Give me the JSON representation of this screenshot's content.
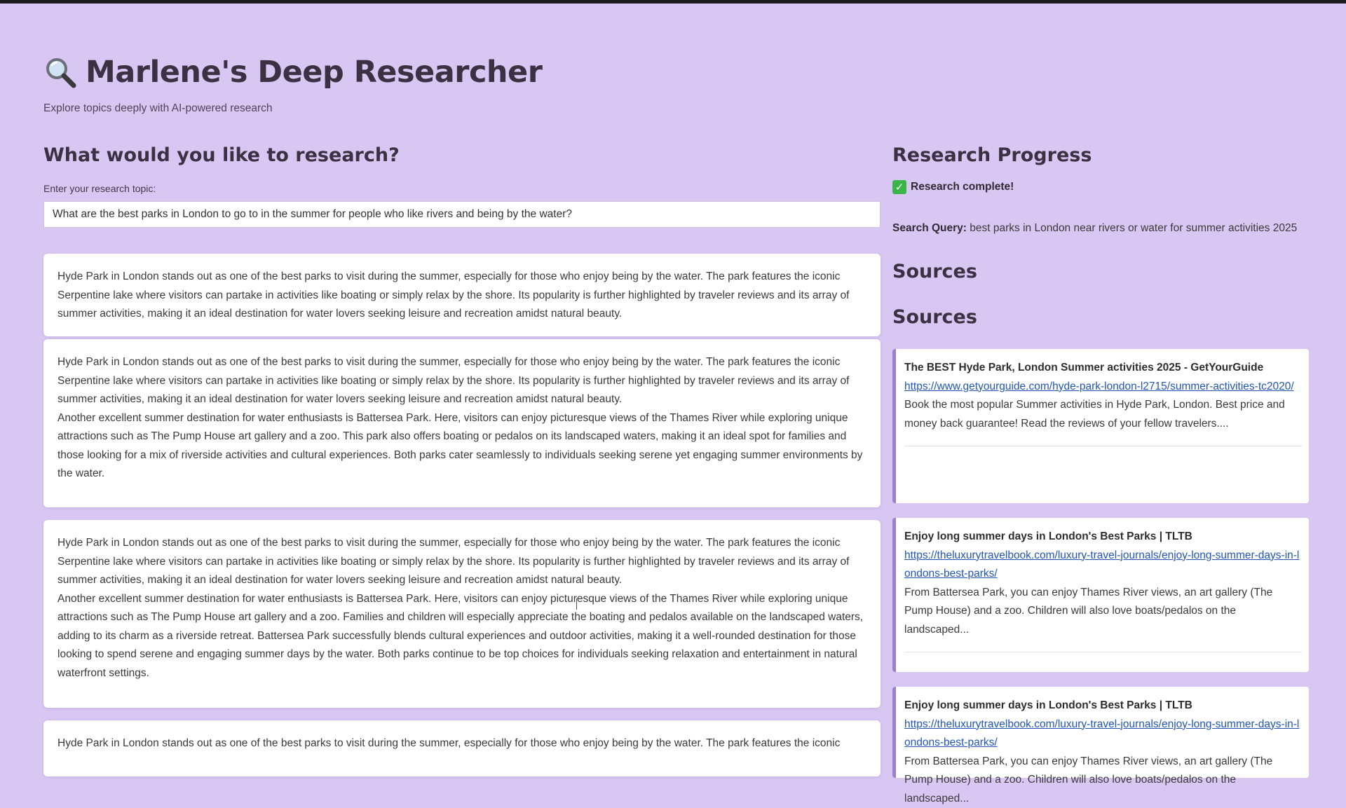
{
  "app": {
    "title": "Marlene's Deep Researcher",
    "subtitle": "Explore topics deeply with AI-powered research",
    "title_icon": "magnifying-glass-icon"
  },
  "research": {
    "heading": "What would you like to research?",
    "input_label": "Enter your research topic:",
    "input_value": "What are the best parks in London to go to in the summer for people who like rivers and being by the water?"
  },
  "results": [
    {
      "paragraphs": [
        "Hyde Park in London stands out as one of the best parks to visit during the summer, especially for those who enjoy being by the water. The park features the iconic Serpentine lake where visitors can partake in activities like boating or simply relax by the shore. Its popularity is further highlighted by traveler reviews and its array of summer activities, making it an ideal destination for water lovers seeking leisure and recreation amidst natural beauty."
      ]
    },
    {
      "paragraphs": [
        "Hyde Park in London stands out as one of the best parks to visit during the summer, especially for those who enjoy being by the water. The park features the iconic Serpentine lake where visitors can partake in activities like boating or simply relax by the shore. Its popularity is further highlighted by traveler reviews and its array of summer activities, making it an ideal destination for water lovers seeking leisure and recreation amidst natural beauty.",
        "Another excellent summer destination for water enthusiasts is Battersea Park. Here, visitors can enjoy picturesque views of the Thames River while exploring unique attractions such as The Pump House art gallery and a zoo. This park also offers boating or pedalos on its landscaped waters, making it an ideal spot for families and those looking for a mix of riverside activities and cultural experiences. Both parks cater seamlessly to individuals seeking serene yet engaging summer environments by the water."
      ]
    },
    {
      "paragraphs": [
        "Hyde Park in London stands out as one of the best parks to visit during the summer, especially for those who enjoy being by the water. The park features the iconic Serpentine lake where visitors can partake in activities like boating or simply relax by the shore. Its popularity is further highlighted by traveler reviews and its array of summer activities, making it an ideal destination for water lovers seeking leisure and recreation amidst natural beauty.",
        "Another excellent summer destination for water enthusiasts is Battersea Park. Here, visitors can enjoy picturesque views of the Thames River while exploring unique attractions such as The Pump House art gallery and a zoo. Families and children will especially appreciate the boating and pedalos available on the landscaped waters, adding to its charm as a riverside retreat. Battersea Park successfully blends cultural experiences and outdoor activities, making it a well-rounded destination for those looking to spend serene and engaging summer days by the water. Both parks continue to be top choices for individuals seeking relaxation and entertainment in natural waterfront settings."
      ]
    },
    {
      "paragraphs": [
        "Hyde Park in London stands out as one of the best parks to visit during the summer, especially for those who enjoy being by the water. The park features the iconic"
      ]
    }
  ],
  "progress": {
    "heading": "Research Progress",
    "status_icon": "check-icon",
    "status_text": "Research complete!",
    "query_label": "Search Query:",
    "query_value": " best parks in London near rivers or water for summer activities 2025",
    "sources_heading_1": "Sources",
    "sources_heading_2": "Sources"
  },
  "sources": [
    {
      "title": "The BEST Hyde Park, London Summer activities 2025 - GetYourGuide",
      "url": "https://www.getyourguide.com/hyde-park-london-l2715/summer-activities-tc2020/",
      "description": "Book the most popular Summer activities in Hyde Park, London. Best price and money back guarantee! Read the reviews of your fellow travelers...."
    },
    {
      "title": "Enjoy long summer days in London's Best Parks | TLTB",
      "url": "https://theluxurytravelbook.com/luxury-travel-journals/enjoy-long-summer-days-in-londons-best-parks/",
      "description": "From Battersea Park, you can enjoy Thames River views, an art gallery (The Pump House) and a zoo. Children will also love boats/pedalos on the landscaped..."
    },
    {
      "title": "Enjoy long summer days in London's Best Parks | TLTB",
      "url": "https://theluxurytravelbook.com/luxury-travel-journals/enjoy-long-summer-days-in-londons-best-parks/",
      "description": "From Battersea Park, you can enjoy Thames River views, an art gallery (The Pump House) and a zoo. Children will also love boats/pedalos on the landscaped..."
    }
  ],
  "colors": {
    "background": "#d9c7f3",
    "accent": "#9b7fd0",
    "link": "#2155b8",
    "success": "#39b54a"
  }
}
